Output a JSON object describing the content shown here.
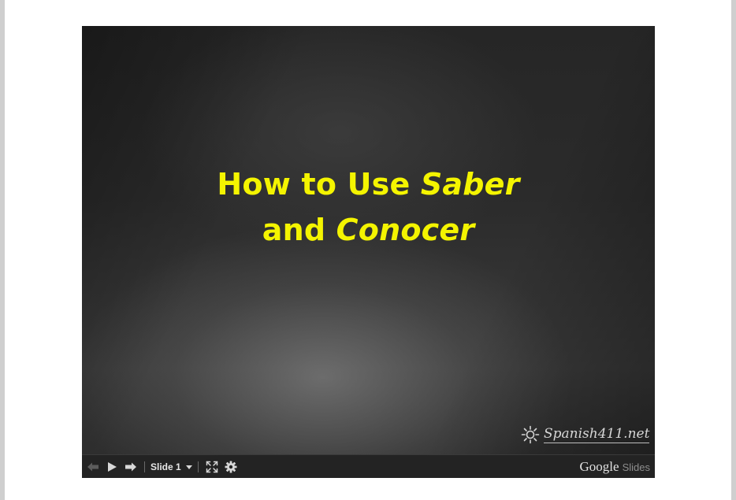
{
  "slide": {
    "title_line1_plain": "How to Use ",
    "title_line1_emph": "Saber",
    "title_line2_plain": "and ",
    "title_line2_emph": "Conocer",
    "title_color": "#f4f400",
    "watermark_text": "Spanish411.net"
  },
  "toolbar": {
    "prev_icon": "arrow-left-icon",
    "play_icon": "play-icon",
    "next_icon": "arrow-right-icon",
    "slide_label": "Slide 1",
    "fullscreen_icon": "fullscreen-icon",
    "settings_icon": "gear-icon"
  },
  "branding": {
    "google": "Google",
    "product": "Slides"
  }
}
